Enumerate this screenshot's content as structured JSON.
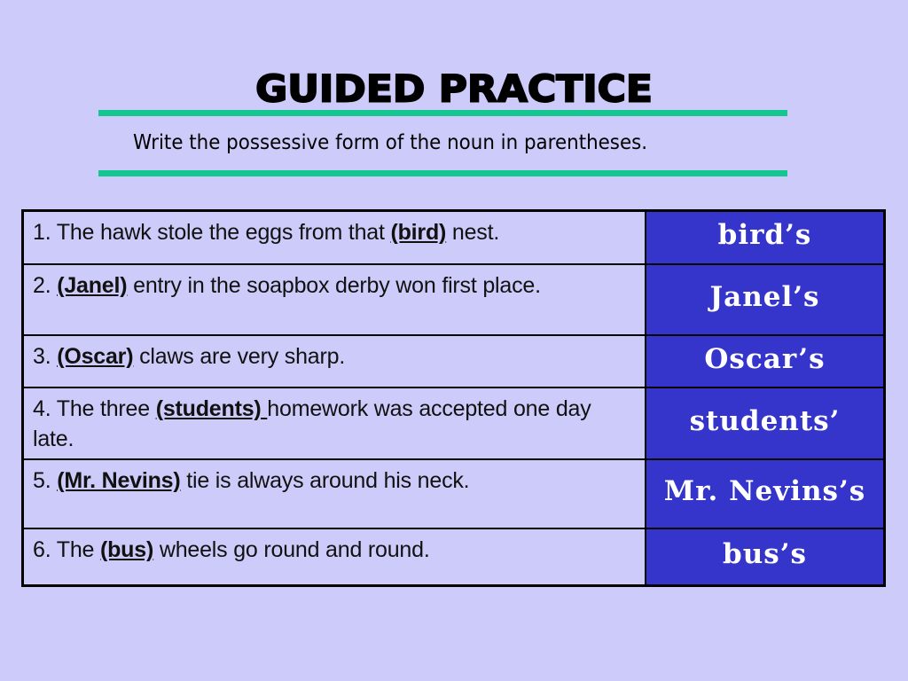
{
  "slide": {
    "title": "Guided Practice",
    "instruction": "Write the possessive form of the noun in parentheses.",
    "colors": {
      "background": "#cccbf9",
      "rule": "#14c690",
      "answer_cell": "#3535cc",
      "answer_text": "#ffffff"
    }
  },
  "items": [
    {
      "number": "1.",
      "before": "The hawk stole the eggs from that ",
      "noun": "(bird)",
      "after": " nest.",
      "answer": "bird’s"
    },
    {
      "number": "2.",
      "before": "",
      "noun": "(Janel)",
      "after": " entry in the soapbox derby won first place.",
      "answer": "Janel’s"
    },
    {
      "number": "3.",
      "before": " ",
      "noun": "(Oscar)",
      "after": " claws are very sharp.",
      "answer": "Oscar’s"
    },
    {
      "number": "4.",
      "before": "The three ",
      "noun": "(students) ",
      "after": "homework was accepted one day late.",
      "answer": "students’"
    },
    {
      "number": "5.",
      "before": "",
      "noun": "(Mr. Nevins)",
      "after": " tie is always around his neck.",
      "answer": "Mr. Nevins’s"
    },
    {
      "number": "6.",
      "before": "The ",
      "noun": "(bus)",
      "after": " wheels go round and round.",
      "answer": "bus’s"
    }
  ]
}
